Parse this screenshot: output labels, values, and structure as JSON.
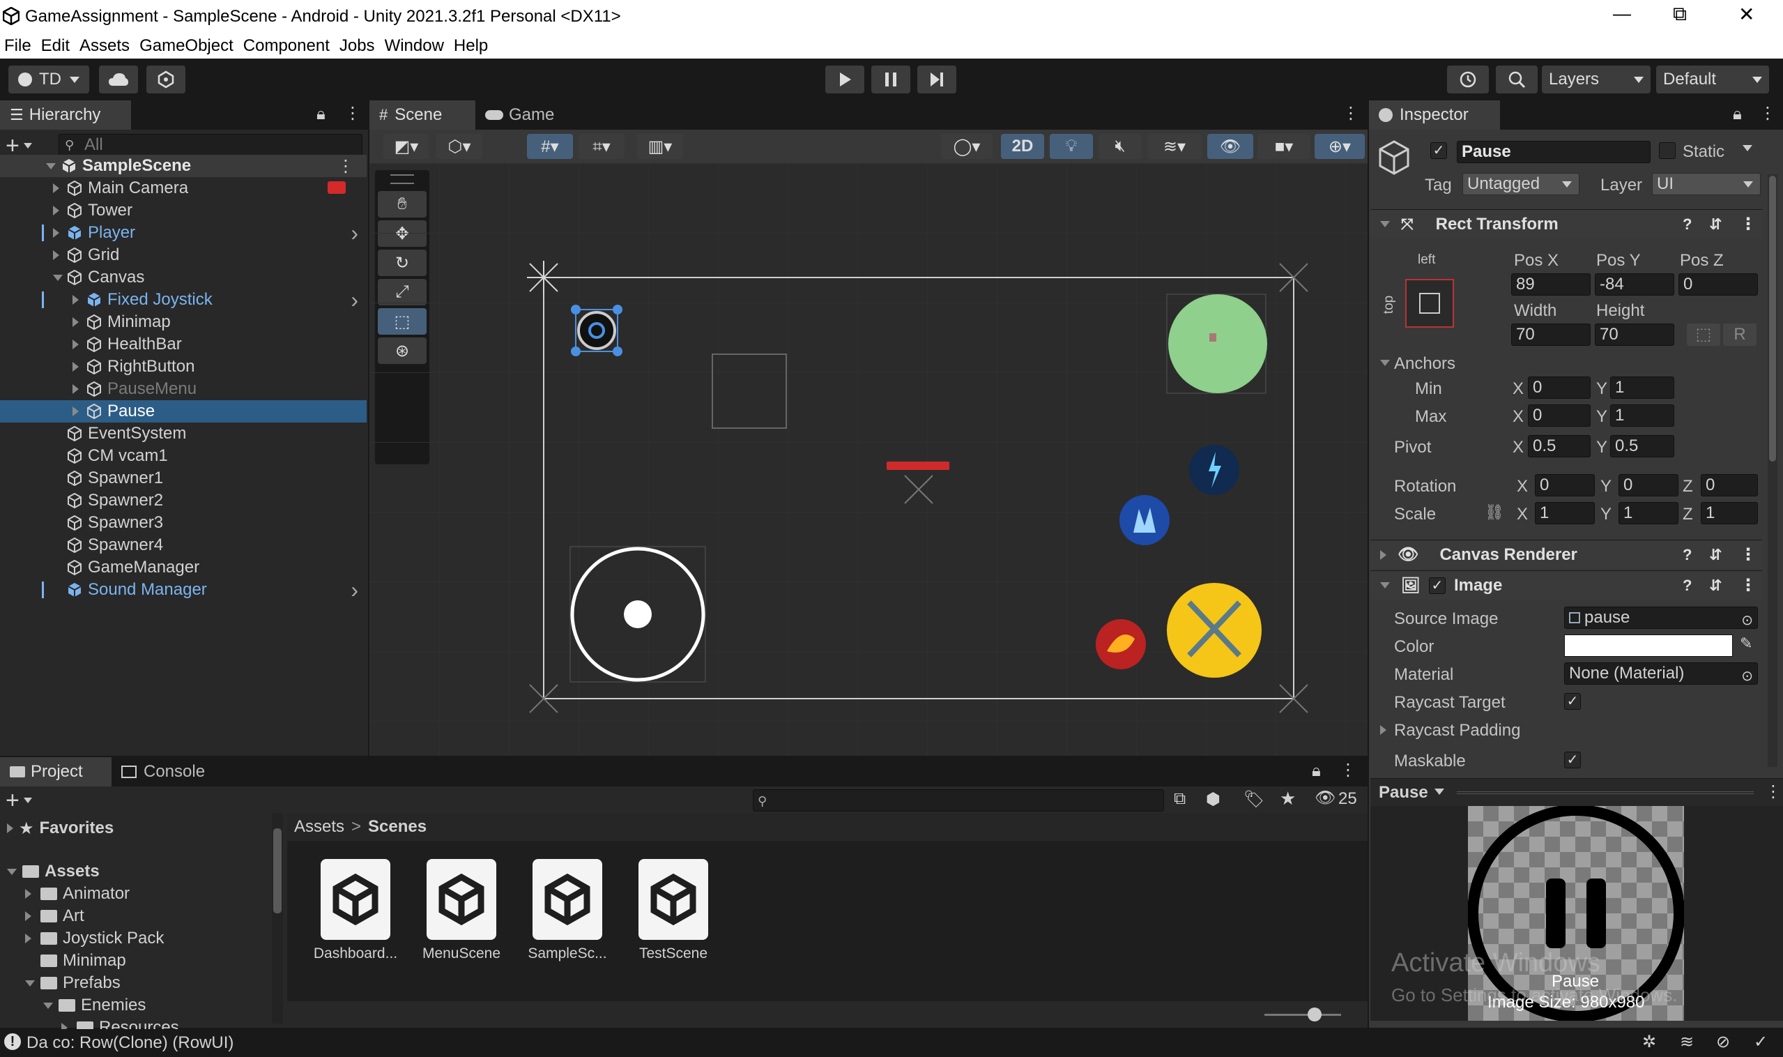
{
  "window": {
    "title": "GameAssignment - SampleScene - Android - Unity 2021.3.2f1 Personal <DX11>",
    "minimize": "—",
    "maximize": "⧉",
    "close": "✕"
  },
  "menu": [
    "File",
    "Edit",
    "Assets",
    "GameObject",
    "Component",
    "Jobs",
    "Window",
    "Help"
  ],
  "toolbar": {
    "account": "TD",
    "layers_label": "Layers",
    "layout_label": "Default"
  },
  "hierarchy": {
    "tab": "Hierarchy",
    "search_placeholder": "All",
    "scene": "SampleScene",
    "items": [
      {
        "label": "Main Camera",
        "depth": 1,
        "color": "normal",
        "expand": "closed"
      },
      {
        "label": "Tower",
        "depth": 1,
        "color": "normal",
        "expand": "closed"
      },
      {
        "label": "Player",
        "depth": 1,
        "color": "blue",
        "expand": "closed"
      },
      {
        "label": "Grid",
        "depth": 1,
        "color": "normal",
        "expand": "closed"
      },
      {
        "label": "Canvas",
        "depth": 1,
        "color": "normal",
        "expand": "open"
      },
      {
        "label": "Fixed Joystick",
        "depth": 2,
        "color": "blue",
        "expand": "closed"
      },
      {
        "label": "Minimap",
        "depth": 2,
        "color": "normal",
        "expand": "closed"
      },
      {
        "label": "HealthBar",
        "depth": 2,
        "color": "normal",
        "expand": "closed"
      },
      {
        "label": "RightButton",
        "depth": 2,
        "color": "normal",
        "expand": "closed"
      },
      {
        "label": "PauseMenu",
        "depth": 2,
        "color": "gray",
        "expand": "closed"
      },
      {
        "label": "Pause",
        "depth": 2,
        "color": "normal",
        "expand": "closed",
        "selected": true
      },
      {
        "label": "EventSystem",
        "depth": 1,
        "color": "normal",
        "expand": "none"
      },
      {
        "label": "CM vcam1",
        "depth": 1,
        "color": "normal",
        "expand": "none"
      },
      {
        "label": "Spawner1",
        "depth": 1,
        "color": "normal",
        "expand": "none"
      },
      {
        "label": "Spawner2",
        "depth": 1,
        "color": "normal",
        "expand": "none"
      },
      {
        "label": "Spawner3",
        "depth": 1,
        "color": "normal",
        "expand": "none"
      },
      {
        "label": "Spawner4",
        "depth": 1,
        "color": "normal",
        "expand": "none"
      },
      {
        "label": "GameManager",
        "depth": 1,
        "color": "normal",
        "expand": "none"
      },
      {
        "label": "Sound Manager",
        "depth": 1,
        "color": "blue",
        "expand": "none"
      }
    ]
  },
  "scene": {
    "tab_scene": "Scene",
    "tab_game": "Game",
    "mode_2d": "2D"
  },
  "inspector": {
    "tab": "Inspector",
    "object_name": "Pause",
    "static_label": "Static",
    "tag_label": "Tag",
    "tag_value": "Untagged",
    "layer_label": "Layer",
    "layer_value": "UI",
    "rect_transform": {
      "title": "Rect Transform",
      "anchor_h": "left",
      "anchor_v": "top",
      "posx_label": "Pos X",
      "posx": "89",
      "posy_label": "Pos Y",
      "posy": "-84",
      "posz_label": "Pos Z",
      "posz": "0",
      "width_label": "Width",
      "width": "70",
      "height_label": "Height",
      "height": "70",
      "r_label": "R",
      "anchors_label": "Anchors",
      "min_label": "Min",
      "min_x": "0",
      "min_y": "1",
      "max_label": "Max",
      "max_x": "0",
      "max_y": "1",
      "pivot_label": "Pivot",
      "pivot_x": "0.5",
      "pivot_y": "0.5",
      "rotation_label": "Rotation",
      "rot_x": "0",
      "rot_y": "0",
      "rot_z": "0",
      "scale_label": "Scale",
      "scale_x": "1",
      "scale_y": "1",
      "scale_z": "1",
      "x": "X",
      "y": "Y",
      "z": "Z"
    },
    "canvas_renderer": "Canvas Renderer",
    "image": {
      "title": "Image",
      "source_image_label": "Source Image",
      "source_image": "pause",
      "color_label": "Color",
      "material_label": "Material",
      "material": "None (Material)",
      "raycast_target_label": "Raycast Target",
      "raycast_padding_label": "Raycast Padding",
      "maskable_label": "Maskable"
    },
    "preview": {
      "title": "Pause",
      "name": "Pause",
      "size": "Image Size: 980x980"
    }
  },
  "project": {
    "tab_project": "Project",
    "tab_console": "Console",
    "favorites": "Favorites",
    "assets": "Assets",
    "folders": [
      {
        "label": "Animator",
        "depth": 1,
        "expand": "closed"
      },
      {
        "label": "Art",
        "depth": 1,
        "expand": "closed"
      },
      {
        "label": "Joystick Pack",
        "depth": 1,
        "expand": "closed"
      },
      {
        "label": "Minimap",
        "depth": 1,
        "expand": "none"
      },
      {
        "label": "Prefabs",
        "depth": 1,
        "expand": "open"
      },
      {
        "label": "Enemies",
        "depth": 2,
        "expand": "open"
      },
      {
        "label": "Resources",
        "depth": 3,
        "expand": "closed"
      }
    ],
    "breadcrumb_root": "Assets",
    "breadcrumb_sep": ">",
    "breadcrumb_current": "Scenes",
    "hidden_count": "25",
    "scene_assets": [
      "Dashboard...",
      "MenuScene",
      "SampleSc...",
      "TestScene"
    ]
  },
  "watermark": {
    "line1": "Activate Windows",
    "line2": "Go to Settings to activate Windows."
  },
  "status": {
    "message": "Da co: Row(Clone) (RowUI)"
  }
}
